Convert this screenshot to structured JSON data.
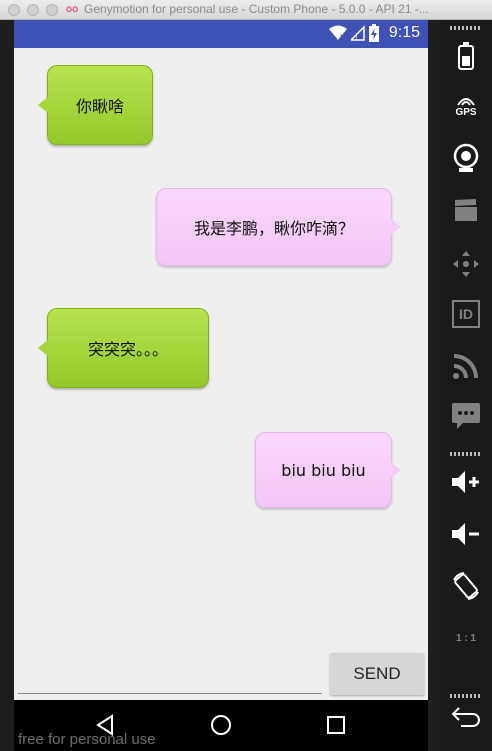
{
  "window": {
    "title": "Genymotion for personal use - Custom Phone - 5.0.0 - API 21 -...",
    "logo": "oo"
  },
  "status_bar": {
    "time": "9:15",
    "icons": [
      "wifi-icon",
      "signal-icon",
      "battery-charging-icon"
    ]
  },
  "chat": {
    "messages": [
      {
        "side": "left",
        "text": "你瞅啥"
      },
      {
        "side": "right",
        "text": "我是李鹏，瞅你咋滴？"
      },
      {
        "side": "left",
        "text": "突突突。。。"
      },
      {
        "side": "right",
        "text": "biu biu biu"
      }
    ],
    "input_value": "",
    "send_label": "SEND"
  },
  "nav": {
    "icons": [
      "back-icon",
      "home-icon",
      "recents-icon"
    ]
  },
  "watermark": "free for personal use",
  "sidebar": {
    "gps_label": "GPS",
    "id_label": "ID",
    "ratio_label": "1 : 1",
    "icons": [
      "battery-icon",
      "gps-icon",
      "camera-icon",
      "clapper-icon",
      "move-icon",
      "id-icon",
      "rss-icon",
      "message-icon",
      "volume-up-icon",
      "volume-down-icon",
      "rotate-icon",
      "pixel-ratio-icon",
      "back-icon"
    ]
  },
  "colors": {
    "status_bar": "#3f51b5",
    "left_bubble": "#a6d63b",
    "right_bubble": "#f4cdf7"
  }
}
